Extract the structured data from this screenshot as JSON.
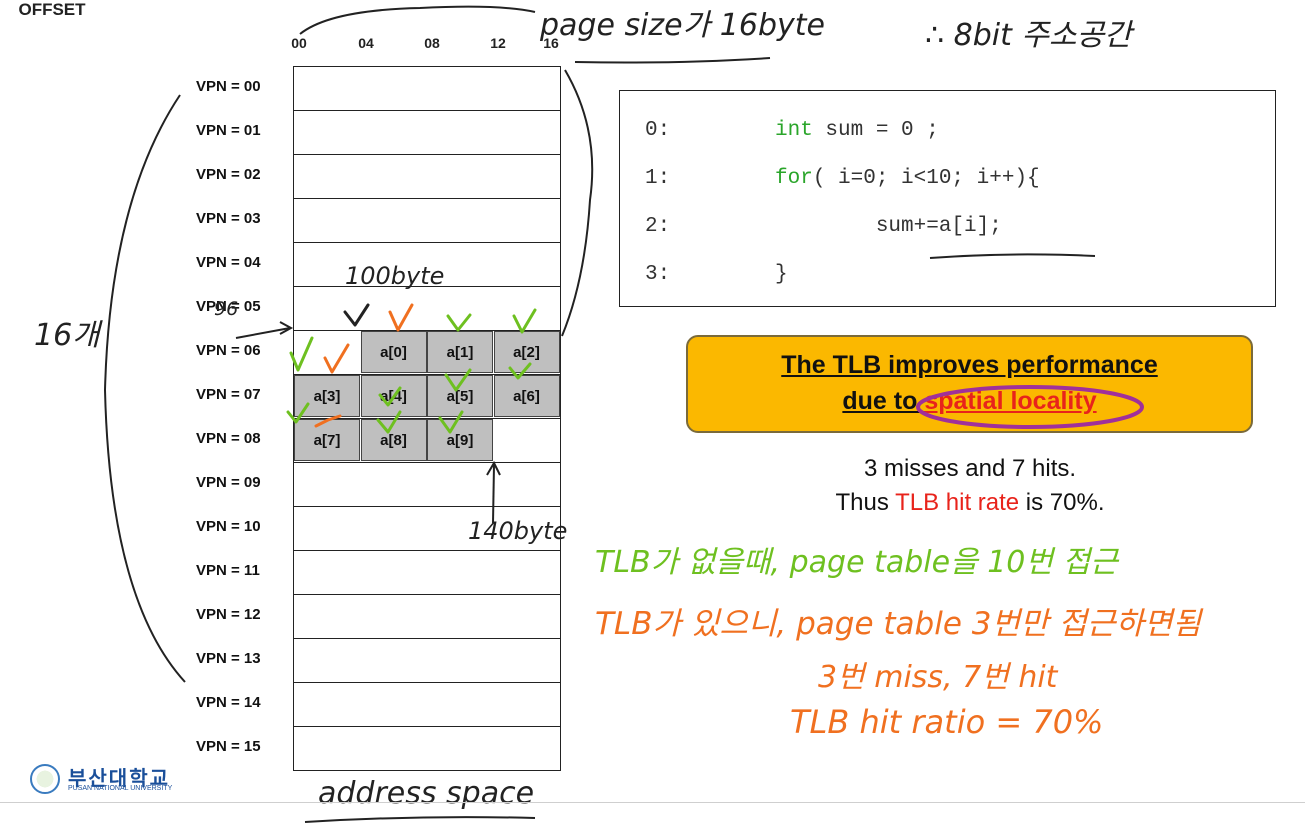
{
  "offset": {
    "title": "OFFSET",
    "ticks": [
      "00",
      "04",
      "08",
      "12",
      "16"
    ]
  },
  "vpn_rows": [
    "VPN = 00",
    "VPN = 01",
    "VPN = 02",
    "VPN = 03",
    "VPN = 04",
    "VPN = 05",
    "VPN = 06",
    "VPN = 07",
    "VPN = 08",
    "VPN = 09",
    "VPN = 10",
    "VPN = 11",
    "VPN = 12",
    "VPN = 13",
    "VPN = 14",
    "VPN = 15"
  ],
  "array_cells": [
    {
      "label": "a[0]",
      "row": 6,
      "col": 1
    },
    {
      "label": "a[1]",
      "row": 6,
      "col": 2
    },
    {
      "label": "a[2]",
      "row": 6,
      "col": 3
    },
    {
      "label": "a[3]",
      "row": 7,
      "col": 0
    },
    {
      "label": "a[4]",
      "row": 7,
      "col": 1
    },
    {
      "label": "a[5]",
      "row": 7,
      "col": 2
    },
    {
      "label": "a[6]",
      "row": 7,
      "col": 3
    },
    {
      "label": "a[7]",
      "row": 8,
      "col": 0
    },
    {
      "label": "a[8]",
      "row": 8,
      "col": 1
    },
    {
      "label": "a[9]",
      "row": 8,
      "col": 2
    }
  ],
  "code": {
    "lines": [
      {
        "num": "0:",
        "keyword": "int",
        "rest": " sum = 0 ;"
      },
      {
        "num": "1:",
        "keyword": "for",
        "rest": "( i=0; i<10; i++){"
      },
      {
        "num": "2:",
        "keyword": "",
        "rest": "        sum+=a[i];"
      },
      {
        "num": "3:",
        "keyword": "",
        "rest": "}"
      }
    ]
  },
  "callout": {
    "line1": "The TLB improves performance",
    "line2_prefix": "due to ",
    "line2_highlight": "spatial locality"
  },
  "stats": {
    "line1": "3 misses and 7 hits.",
    "line2_prefix": "Thus ",
    "line2_red": "TLB hit rate",
    "line2_suffix": " is 70%."
  },
  "handwriting": {
    "page_size": "page size가 16byte",
    "address_space": "∴ 8bit 주소공간",
    "count": "16개",
    "addr_96": "96",
    "addr_100": "100byte",
    "addr_140": "140byte",
    "address_space_bottom": "address space",
    "note_green": "TLB가 없을때, page table을 10번 접근",
    "note_orange_1": "TLB가 있으니, page table 3번만 접근하면됨",
    "note_orange_2": "3번 miss, 7번 hit",
    "note_orange_3": "TLB hit ratio = 70%"
  },
  "logo": {
    "korean": "부산대학교",
    "english": "PUSAN NATIONAL UNIVERSITY"
  },
  "colors": {
    "highlight_orange": "#fbb800",
    "red": "#e8231b",
    "green_ink": "#6ec020",
    "orange_ink": "#f07020",
    "purple_ink": "#a0309a",
    "cell_gray": "#bfbfbf"
  }
}
